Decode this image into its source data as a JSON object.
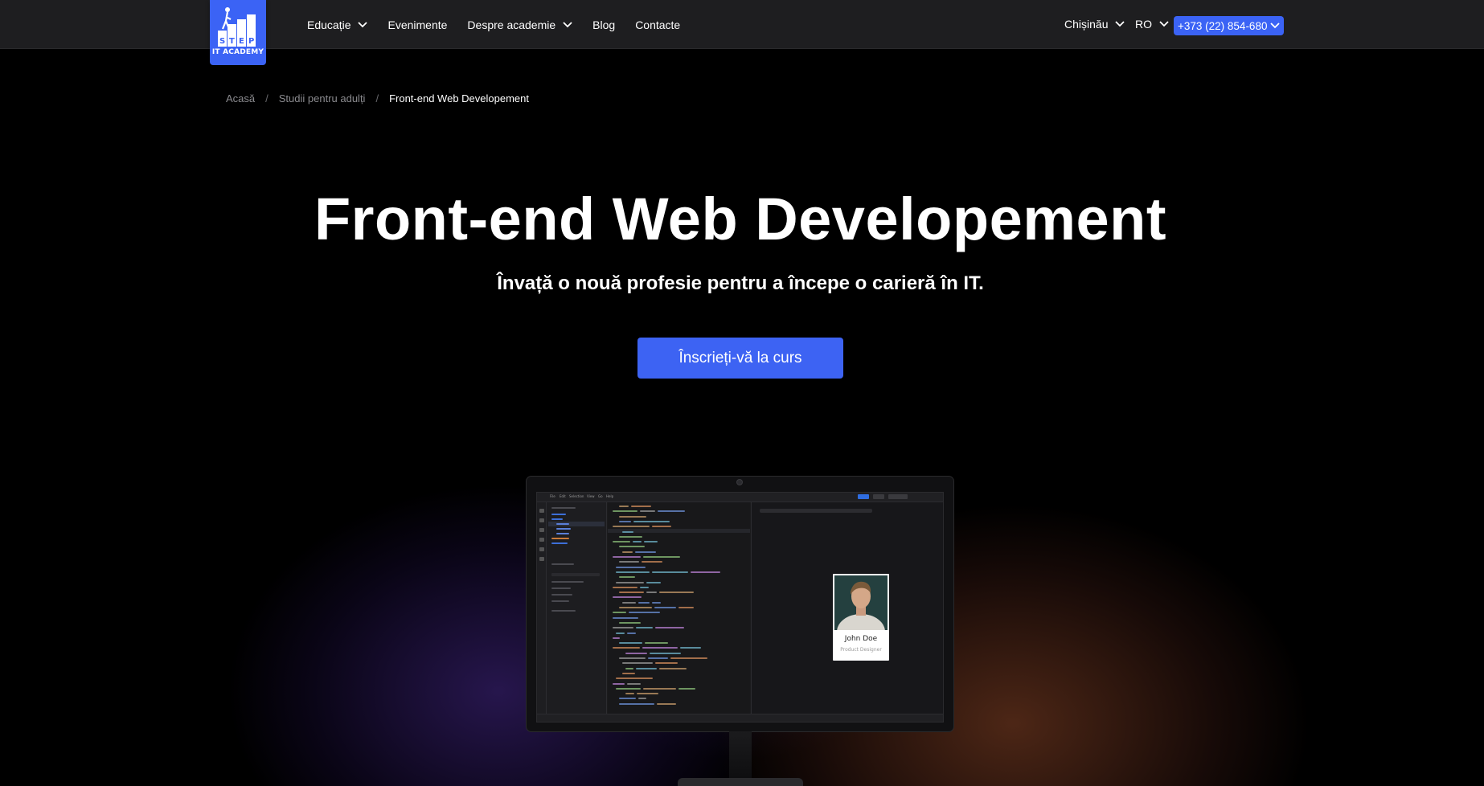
{
  "header": {
    "logo": {
      "line1": "STEP",
      "line2": "IT ACADEMY",
      "icon": "step-logo-icon"
    },
    "nav": [
      {
        "label": "Educație",
        "has_dropdown": true
      },
      {
        "label": "Evenimente",
        "has_dropdown": false
      },
      {
        "label": "Despre academie",
        "has_dropdown": true
      },
      {
        "label": "Blog",
        "has_dropdown": false
      },
      {
        "label": "Contacte",
        "has_dropdown": false
      }
    ],
    "city": "Chișinău",
    "language": "RO",
    "phone": "+373 (22) 854-680"
  },
  "breadcrumb": {
    "home": "Acasă",
    "section": "Studii pentru adulți",
    "current": "Front-end Web Developement",
    "separator": "/"
  },
  "hero": {
    "title": "Front-end Web Developement",
    "subtitle": "Învață o nouă profesie pentru a începe o carieră în IT.",
    "cta_label": "Înscrieți-vă la curs"
  },
  "illustration": {
    "profile_name": "John Doe",
    "profile_role": "Product Designer"
  },
  "colors": {
    "header_bg": "#1e1e20",
    "accent": "#3b63f5",
    "page_bg": "#000000"
  }
}
